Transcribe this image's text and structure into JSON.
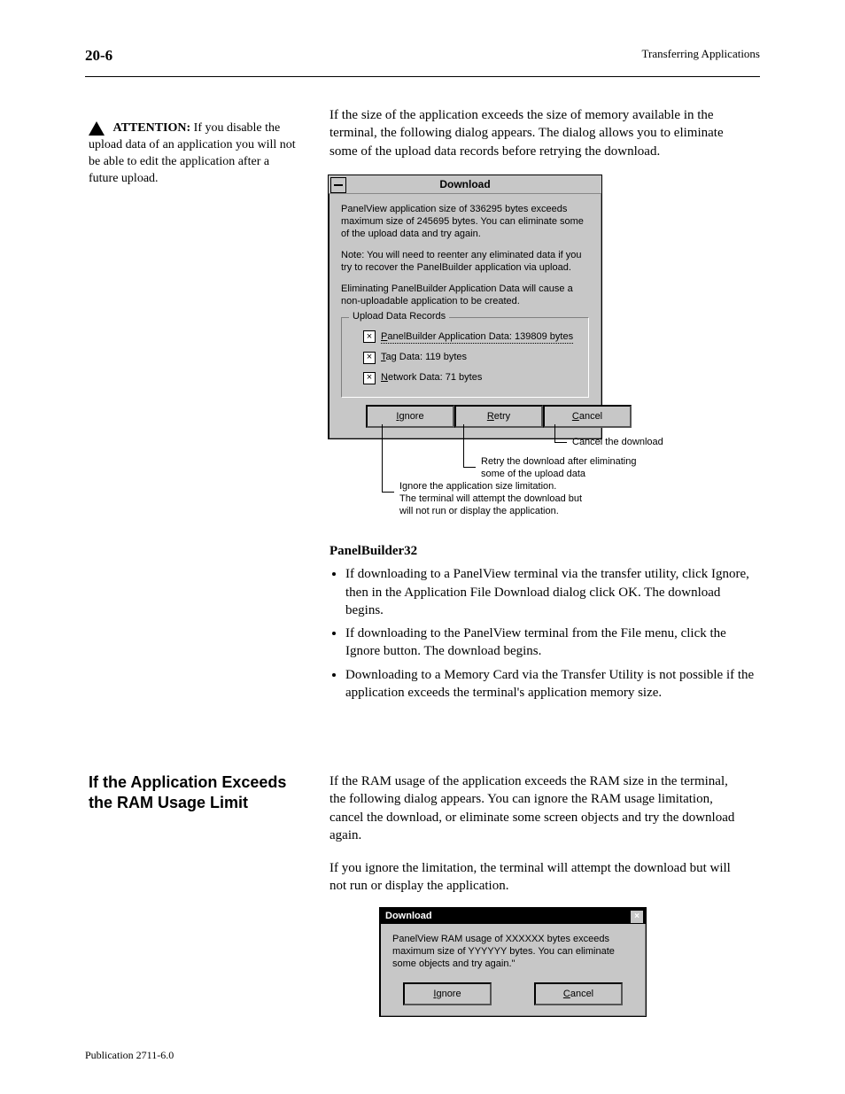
{
  "header": {
    "left": "20-6",
    "right": "Transferring Applications"
  },
  "footer": {
    "pub": "Publication 2711-6.0"
  },
  "intro": {
    "p1": "If the size of the application exceeds the size of memory available in the terminal, the following dialog appears. The dialog allows you to eliminate some of the upload data records before retrying the download.",
    "att_title": "ATTENTION:",
    "att_body": " If you disable the upload data of an application you will not be able to edit the application after a future upload."
  },
  "dlg1": {
    "title": "Download",
    "p1": "PanelView application size of 336295 bytes exceeds maximum size of 245695 bytes.  You can eliminate some of the upload data and try again.",
    "p2": "Note: You will need to reenter any eliminated data if you try to recover the PanelBuilder application via upload.",
    "p3": "Eliminating PanelBuilder Application Data will cause a non-uploadable application to be created.",
    "group_title": "Upload Data Records",
    "chk1": {
      "u": "P",
      "rest": "anelBuilder Application Data: 139809 bytes"
    },
    "chk2": {
      "u": "T",
      "rest": "ag Data: 119 bytes"
    },
    "chk3": {
      "u": "N",
      "rest": "etwork Data: 71 bytes"
    },
    "btn_ignore": {
      "u": "I",
      "rest": "gnore"
    },
    "btn_retry": {
      "u": "R",
      "rest": "etry"
    },
    "btn_cancel": {
      "u": "C",
      "rest": "ancel"
    }
  },
  "callouts": {
    "cancel": "Cancel the download",
    "retry_l1": "Retry the download after eliminating",
    "retry_l2": "some of the upload data",
    "ignore_l1": "Ignore the application size limitation.",
    "ignore_l2": "The terminal will attempt the download but",
    "ignore_l3": "will not run or display the application."
  },
  "section": {
    "pb_li1": "If downloading to a PanelView terminal via the transfer utility, click Ignore, then in the Application File Download dialog click OK. The download begins.",
    "pb_li2": "If downloading to the PanelView terminal from the File menu, click the Ignore button. The download begins.",
    "pb_li3": "Downloading to a Memory Card via the Transfer Utility is not possible if the application exceeds the terminal's application memory size.",
    "ram_p1": "If the RAM usage of the application exceeds the RAM size in the terminal, the following dialog appears. You can ignore the RAM usage limitation, cancel the download, or eliminate some screen objects and try the download again.",
    "ram_p2": "If you ignore the limitation, the terminal will attempt the download but will not run or display the application."
  },
  "side": {
    "l1": "If the Application Exceeds",
    "l2": "the RAM Usage Limit"
  },
  "dlg2": {
    "title": "Download",
    "body": "PanelView RAM usage of XXXXXX bytes exceeds maximum size of YYYYYY bytes.  You can eliminate some objects and try again.\"",
    "btn_ignore": {
      "u": "I",
      "rest": "gnore"
    },
    "btn_cancel": {
      "u": "C",
      "rest": "ancel"
    }
  }
}
